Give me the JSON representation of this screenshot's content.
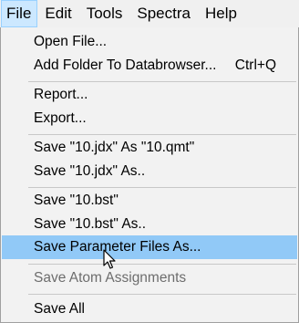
{
  "menubar": {
    "items": [
      {
        "label": "File"
      },
      {
        "label": "Edit"
      },
      {
        "label": "Tools"
      },
      {
        "label": "Spectra"
      },
      {
        "label": "Help"
      }
    ]
  },
  "file_menu": {
    "open_file": "Open File...",
    "add_folder": "Add Folder To Databrowser...",
    "add_folder_shortcut": "Ctrl+Q",
    "report": "Report...",
    "export": "Export...",
    "save_jdx_as_qmt": "Save \"10.jdx\" As \"10.qmt\"",
    "save_jdx_as": "Save \"10.jdx\" As..",
    "save_bst": "Save \"10.bst\"",
    "save_bst_as": "Save \"10.bst\" As..",
    "save_parameter_files": "Save Parameter Files As...",
    "save_atom_assignments": "Save Atom Assignments",
    "save_all": "Save All"
  },
  "colors": {
    "highlight": "#91c9f7",
    "active_menubar": "#cce8ff",
    "disabled_text": "#6d6d6d"
  }
}
